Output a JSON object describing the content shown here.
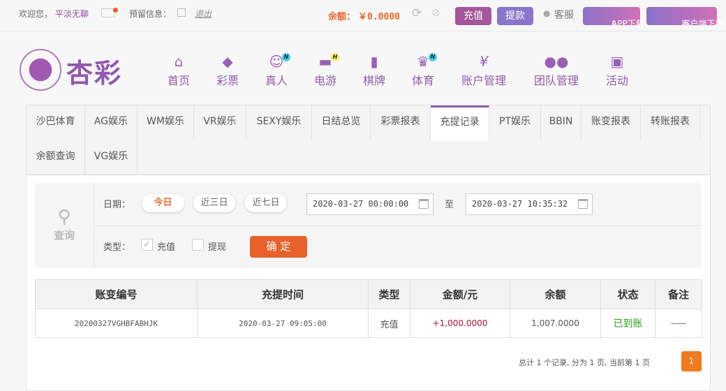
{
  "topbar": {
    "welcome": "欢迎您，",
    "username": "平淡无聊",
    "reserve_label": "预留信息：",
    "logout": "退出",
    "balance_label": "余额：",
    "balance": "￥0.0000",
    "recharge": "充值",
    "withdraw": "提款",
    "service": "客服",
    "app_download": "APP下载",
    "client_download": "客户端下载"
  },
  "logo": {
    "text": "杏彩"
  },
  "nav": [
    {
      "label": "首页",
      "icon": "home-icon"
    },
    {
      "label": "彩票",
      "icon": "ticket-icon"
    },
    {
      "label": "真人",
      "icon": "lady-icon",
      "badge": "N"
    },
    {
      "label": "电游",
      "icon": "gamepad-icon",
      "badge": "H"
    },
    {
      "label": "棋牌",
      "icon": "cards-icon"
    },
    {
      "label": "体育",
      "icon": "trophy-icon",
      "badge": "N"
    },
    {
      "label": "账户管理",
      "icon": "yen-icon"
    },
    {
      "label": "团队管理",
      "icon": "team-icon"
    },
    {
      "label": "活动",
      "icon": "gift-icon"
    }
  ],
  "tabs": [
    "沙巴体育",
    "AG娱乐",
    "WM娱乐",
    "VR娱乐",
    "SEXY娱乐",
    "日结总览",
    "彩票报表",
    "充提记录",
    "PT娱乐",
    "BBIN",
    "账变报表",
    "转账报表",
    "余额查询",
    "VG娱乐"
  ],
  "filter": {
    "search_label": "查询",
    "date_label": "日期：",
    "today": "今日",
    "three_days": "近三日",
    "seven_days": "近七日",
    "start": "2020-03-27 00:00:00",
    "to": "至",
    "end": "2020-03-27 10:35:32",
    "type_label": "类型：",
    "recharge": "充值",
    "withdraw": "提现",
    "confirm": "确 定"
  },
  "table": {
    "headers": [
      "账变编号",
      "充提时间",
      "类型",
      "金额/元",
      "余额",
      "状态",
      "备注"
    ],
    "rows": [
      [
        "20200327VGHBFABHJK",
        "2020-03-27 09:05:00",
        "充值",
        "+1,000.0000",
        "1,007.0000",
        "已到账",
        "-----"
      ]
    ]
  },
  "pagination": {
    "summary": "总计 1 个记录, 分为 1 页, 当前第 1 页",
    "page": "1"
  }
}
